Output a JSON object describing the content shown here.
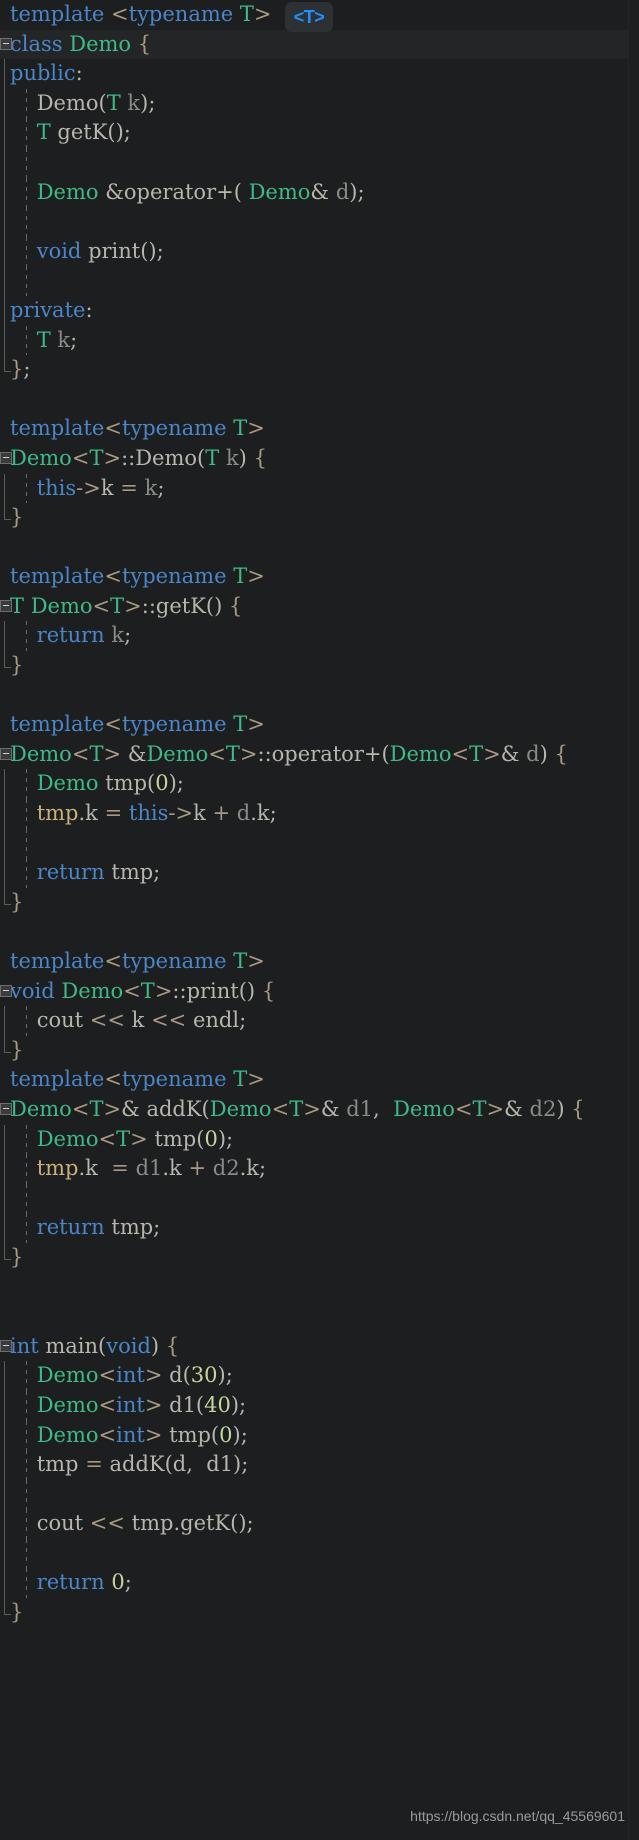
{
  "editor": {
    "background_color": "#1d1e1f",
    "watermark": "https://blog.csdn.net/qq_45569601",
    "tooltip_badge": "<T>",
    "colors": {
      "keyword": "#4a86c8",
      "type": "#3fb98a",
      "plain": "#b6b6ae",
      "variable": "#8a8a86",
      "number": "#c3d69b",
      "operator": "#a89a82",
      "tmp_identifier": "#c9b07a",
      "highlight_bg": "#242526",
      "highlight_border": "#55585a"
    },
    "language": "C++",
    "lines": [
      {
        "n": 1,
        "indent": 0,
        "fold": "none",
        "guide": false,
        "bar": "none",
        "html": "<span class=\"kw\">template</span> <span class=\"op\">&lt;</span><span class=\"kw\">typename</span> <span class=\"typ\">T</span><span class=\"op\">&gt;</span>"
      },
      {
        "n": 2,
        "indent": 0,
        "fold": "open",
        "guide": false,
        "bar": "none",
        "highlight": true,
        "html": "<span class=\"kw\">class</span> <span class=\"typ\">Demo</span> <span class=\"brc\">{</span>"
      },
      {
        "n": 3,
        "indent": 0,
        "fold": "none",
        "guide": false,
        "bar": "start",
        "html": "<span class=\"kw\">public</span><span class=\"pln\">:</span>"
      },
      {
        "n": 4,
        "indent": 1,
        "fold": "none",
        "guide": true,
        "bar": "mid",
        "html": "    <span class=\"pln\">Demo(</span><span class=\"typ\">T</span> <span class=\"var\">k</span><span class=\"pln\">);</span>"
      },
      {
        "n": 5,
        "indent": 1,
        "fold": "none",
        "guide": true,
        "bar": "mid",
        "html": "    <span class=\"typ\">T</span> <span class=\"pln\">getK();</span>"
      },
      {
        "n": 6,
        "indent": 1,
        "fold": "none",
        "guide": true,
        "bar": "mid",
        "html": ""
      },
      {
        "n": 7,
        "indent": 1,
        "fold": "none",
        "guide": true,
        "bar": "mid",
        "html": "    <span class=\"typ\">Demo</span> <span class=\"pln\">&amp;operator+(</span> <span class=\"typ\">Demo</span><span class=\"pln\">&amp;</span> <span class=\"var\">d</span><span class=\"pln\">);</span>"
      },
      {
        "n": 8,
        "indent": 1,
        "fold": "none",
        "guide": true,
        "bar": "mid",
        "html": ""
      },
      {
        "n": 9,
        "indent": 1,
        "fold": "none",
        "guide": true,
        "bar": "mid",
        "html": "    <span class=\"kw\">void</span> <span class=\"pln\">print();</span>"
      },
      {
        "n": 10,
        "indent": 1,
        "fold": "none",
        "guide": true,
        "bar": "mid",
        "html": ""
      },
      {
        "n": 11,
        "indent": 0,
        "fold": "none",
        "guide": false,
        "bar": "mid",
        "html": "<span class=\"kw\">private</span><span class=\"pln\">:</span>"
      },
      {
        "n": 12,
        "indent": 1,
        "fold": "none",
        "guide": true,
        "bar": "mid",
        "html": "    <span class=\"typ\">T</span> <span class=\"var\">k</span><span class=\"pln\">;</span>"
      },
      {
        "n": 13,
        "indent": 0,
        "fold": "none",
        "guide": false,
        "bar": "end",
        "html": "<span class=\"brc\">}</span><span class=\"pln\">;</span>"
      },
      {
        "n": 14,
        "indent": 0,
        "fold": "none",
        "guide": false,
        "bar": "none",
        "html": ""
      },
      {
        "n": 15,
        "indent": 0,
        "fold": "none",
        "guide": false,
        "bar": "none",
        "html": "<span class=\"kw\">template</span><span class=\"op\">&lt;</span><span class=\"kw\">typename</span> <span class=\"typ\">T</span><span class=\"op\">&gt;</span>"
      },
      {
        "n": 16,
        "indent": 0,
        "fold": "open",
        "guide": false,
        "bar": "none",
        "html": "<span class=\"typ\">Demo</span><span class=\"op\">&lt;</span><span class=\"typ\">T</span><span class=\"op\">&gt;</span><span class=\"pln\">::Demo(</span><span class=\"typ\">T</span> <span class=\"var\">k</span><span class=\"pln\">)</span> <span class=\"brc\">{</span>"
      },
      {
        "n": 17,
        "indent": 1,
        "fold": "none",
        "guide": true,
        "bar": "start",
        "html": "    <span class=\"kw\">this</span><span class=\"op\">-&gt;</span><span class=\"pln\">k</span> <span class=\"op\">=</span> <span class=\"var\">k</span><span class=\"pln\">;</span>"
      },
      {
        "n": 18,
        "indent": 0,
        "fold": "none",
        "guide": false,
        "bar": "end",
        "html": "<span class=\"brc\">}</span>"
      },
      {
        "n": 19,
        "indent": 0,
        "fold": "none",
        "guide": false,
        "bar": "none",
        "html": ""
      },
      {
        "n": 20,
        "indent": 0,
        "fold": "none",
        "guide": false,
        "bar": "none",
        "html": "<span class=\"kw\">template</span><span class=\"op\">&lt;</span><span class=\"kw\">typename</span> <span class=\"typ\">T</span><span class=\"op\">&gt;</span>"
      },
      {
        "n": 21,
        "indent": 0,
        "fold": "open",
        "guide": false,
        "bar": "none",
        "html": "<span class=\"typ\">T</span> <span class=\"typ\">Demo</span><span class=\"op\">&lt;</span><span class=\"typ\">T</span><span class=\"op\">&gt;</span><span class=\"pln\">::getK()</span> <span class=\"brc\">{</span>"
      },
      {
        "n": 22,
        "indent": 1,
        "fold": "none",
        "guide": true,
        "bar": "start",
        "html": "    <span class=\"kw\">return</span> <span class=\"var\">k</span><span class=\"pln\">;</span>"
      },
      {
        "n": 23,
        "indent": 0,
        "fold": "none",
        "guide": false,
        "bar": "end",
        "html": "<span class=\"brc\">}</span>"
      },
      {
        "n": 24,
        "indent": 0,
        "fold": "none",
        "guide": false,
        "bar": "none",
        "html": ""
      },
      {
        "n": 25,
        "indent": 0,
        "fold": "none",
        "guide": false,
        "bar": "none",
        "html": "<span class=\"kw\">template</span><span class=\"op\">&lt;</span><span class=\"kw\">typename</span> <span class=\"typ\">T</span><span class=\"op\">&gt;</span>"
      },
      {
        "n": 26,
        "indent": 0,
        "fold": "open",
        "guide": false,
        "bar": "none",
        "html": "<span class=\"typ\">Demo</span><span class=\"op\">&lt;</span><span class=\"typ\">T</span><span class=\"op\">&gt;</span> <span class=\"pln\">&amp;</span><span class=\"typ\">Demo</span><span class=\"op\">&lt;</span><span class=\"typ\">T</span><span class=\"op\">&gt;</span><span class=\"pln\">::operator+(</span><span class=\"typ\">Demo</span><span class=\"op\">&lt;</span><span class=\"typ\">T</span><span class=\"op\">&gt;</span><span class=\"pln\">&amp;</span> <span class=\"var\">d</span><span class=\"pln\">)</span> <span class=\"brc\">{</span>"
      },
      {
        "n": 27,
        "indent": 1,
        "fold": "none",
        "guide": true,
        "bar": "start",
        "html": "    <span class=\"typ\">Demo</span> <span class=\"pln\">tmp(</span><span class=\"num\">0</span><span class=\"pln\">);</span>"
      },
      {
        "n": 28,
        "indent": 1,
        "fold": "none",
        "guide": true,
        "bar": "mid",
        "html": "    <span class=\"tmpv\">tmp</span><span class=\"pln\">.k</span> <span class=\"op\">=</span> <span class=\"kw\">this</span><span class=\"op\">-&gt;</span><span class=\"pln\">k</span> <span class=\"op\">+</span> <span class=\"var\">d</span><span class=\"pln\">.k;</span>"
      },
      {
        "n": 29,
        "indent": 1,
        "fold": "none",
        "guide": true,
        "bar": "mid",
        "html": ""
      },
      {
        "n": 30,
        "indent": 1,
        "fold": "none",
        "guide": true,
        "bar": "mid",
        "html": "    <span class=\"kw\">return</span> <span class=\"pln\">tmp;</span>"
      },
      {
        "n": 31,
        "indent": 0,
        "fold": "none",
        "guide": false,
        "bar": "end",
        "html": "<span class=\"brc\">}</span>"
      },
      {
        "n": 32,
        "indent": 0,
        "fold": "none",
        "guide": false,
        "bar": "none",
        "html": ""
      },
      {
        "n": 33,
        "indent": 0,
        "fold": "none",
        "guide": false,
        "bar": "none",
        "html": "<span class=\"kw\">template</span><span class=\"op\">&lt;</span><span class=\"kw\">typename</span> <span class=\"typ\">T</span><span class=\"op\">&gt;</span>"
      },
      {
        "n": 34,
        "indent": 0,
        "fold": "open",
        "guide": false,
        "bar": "none",
        "html": "<span class=\"kw\">void</span> <span class=\"typ\">Demo</span><span class=\"op\">&lt;</span><span class=\"typ\">T</span><span class=\"op\">&gt;</span><span class=\"pln\">::print()</span> <span class=\"brc\">{</span>"
      },
      {
        "n": 35,
        "indent": 1,
        "fold": "none",
        "guide": true,
        "bar": "start",
        "html": "    <span class=\"pln\">cout</span> <span class=\"op\">&lt;&lt;</span> <span class=\"pln\">k</span> <span class=\"op\">&lt;&lt;</span> <span class=\"pln\">endl;</span>"
      },
      {
        "n": 36,
        "indent": 0,
        "fold": "none",
        "guide": false,
        "bar": "end",
        "html": "<span class=\"brc\">}</span>"
      },
      {
        "n": 37,
        "indent": 0,
        "fold": "none",
        "guide": false,
        "bar": "none",
        "html": "<span class=\"kw\">template</span><span class=\"op\">&lt;</span><span class=\"kw\">typename</span> <span class=\"typ\">T</span><span class=\"op\">&gt;</span>"
      },
      {
        "n": 38,
        "indent": 0,
        "fold": "open",
        "guide": false,
        "bar": "none",
        "html": "<span class=\"typ\">Demo</span><span class=\"op\">&lt;</span><span class=\"typ\">T</span><span class=\"op\">&gt;</span><span class=\"pln\">&amp;</span> <span class=\"pln\">addK(</span><span class=\"typ\">Demo</span><span class=\"op\">&lt;</span><span class=\"typ\">T</span><span class=\"op\">&gt;</span><span class=\"pln\">&amp;</span> <span class=\"var\">d1</span><span class=\"pln\">,</span>  <span class=\"typ\">Demo</span><span class=\"op\">&lt;</span><span class=\"typ\">T</span><span class=\"op\">&gt;</span><span class=\"pln\">&amp;</span> <span class=\"var\">d2</span><span class=\"pln\">)</span> <span class=\"brc\">{</span>"
      },
      {
        "n": 39,
        "indent": 1,
        "fold": "none",
        "guide": true,
        "bar": "start",
        "html": "    <span class=\"typ\">Demo</span><span class=\"op\">&lt;</span><span class=\"typ\">T</span><span class=\"op\">&gt;</span> <span class=\"pln\">tmp(</span><span class=\"num\">0</span><span class=\"pln\">);</span>"
      },
      {
        "n": 40,
        "indent": 1,
        "fold": "none",
        "guide": true,
        "bar": "mid",
        "html": "    <span class=\"tmpv\">tmp</span><span class=\"pln\">.k</span>  <span class=\"op\">=</span> <span class=\"var\">d1</span><span class=\"pln\">.k</span> <span class=\"op\">+</span> <span class=\"var\">d2</span><span class=\"pln\">.k;</span>"
      },
      {
        "n": 41,
        "indent": 1,
        "fold": "none",
        "guide": true,
        "bar": "mid",
        "html": ""
      },
      {
        "n": 42,
        "indent": 1,
        "fold": "none",
        "guide": true,
        "bar": "mid",
        "html": "    <span class=\"kw\">return</span> <span class=\"pln\">tmp;</span>"
      },
      {
        "n": 43,
        "indent": 0,
        "fold": "none",
        "guide": false,
        "bar": "end",
        "html": "<span class=\"brc\">}</span>"
      },
      {
        "n": 44,
        "indent": 0,
        "fold": "none",
        "guide": false,
        "bar": "none",
        "html": ""
      },
      {
        "n": 45,
        "indent": 0,
        "fold": "none",
        "guide": false,
        "bar": "none",
        "html": ""
      },
      {
        "n": 46,
        "indent": 0,
        "fold": "open",
        "guide": false,
        "bar": "none",
        "html": "<span class=\"kw\">int</span> <span class=\"pln\">main(</span><span class=\"kw\">void</span><span class=\"pln\">)</span> <span class=\"brc\">{</span>"
      },
      {
        "n": 47,
        "indent": 1,
        "fold": "none",
        "guide": true,
        "bar": "start",
        "html": "    <span class=\"typ\">Demo</span><span class=\"op\">&lt;</span><span class=\"kw\">int</span><span class=\"op\">&gt;</span> <span class=\"pln\">d(</span><span class=\"num\">30</span><span class=\"pln\">);</span>"
      },
      {
        "n": 48,
        "indent": 1,
        "fold": "none",
        "guide": true,
        "bar": "mid",
        "html": "    <span class=\"typ\">Demo</span><span class=\"op\">&lt;</span><span class=\"kw\">int</span><span class=\"op\">&gt;</span> <span class=\"pln\">d1(</span><span class=\"num\">40</span><span class=\"pln\">);</span>"
      },
      {
        "n": 49,
        "indent": 1,
        "fold": "none",
        "guide": true,
        "bar": "mid",
        "html": "    <span class=\"typ\">Demo</span><span class=\"op\">&lt;</span><span class=\"kw\">int</span><span class=\"op\">&gt;</span> <span class=\"pln\">tmp(</span><span class=\"num\">0</span><span class=\"pln\">);</span>"
      },
      {
        "n": 50,
        "indent": 1,
        "fold": "none",
        "guide": true,
        "bar": "mid",
        "html": "    <span class=\"pln\">tmp</span> <span class=\"op\">=</span> <span class=\"pln\">addK(d,</span>  <span class=\"pln\">d1);</span>"
      },
      {
        "n": 51,
        "indent": 1,
        "fold": "none",
        "guide": true,
        "bar": "mid",
        "html": ""
      },
      {
        "n": 52,
        "indent": 1,
        "fold": "none",
        "guide": true,
        "bar": "mid",
        "html": "    <span class=\"pln\">cout</span> <span class=\"op\">&lt;&lt;</span> <span class=\"pln\">tmp.getK();</span>"
      },
      {
        "n": 53,
        "indent": 1,
        "fold": "none",
        "guide": true,
        "bar": "mid",
        "html": ""
      },
      {
        "n": 54,
        "indent": 1,
        "fold": "none",
        "guide": true,
        "bar": "mid",
        "html": "    <span class=\"kw\">return</span> <span class=\"num\">0</span><span class=\"pln\">;</span>"
      },
      {
        "n": 55,
        "indent": 0,
        "fold": "none",
        "guide": false,
        "bar": "end",
        "html": "<span class=\"brc\">}</span>"
      }
    ]
  }
}
